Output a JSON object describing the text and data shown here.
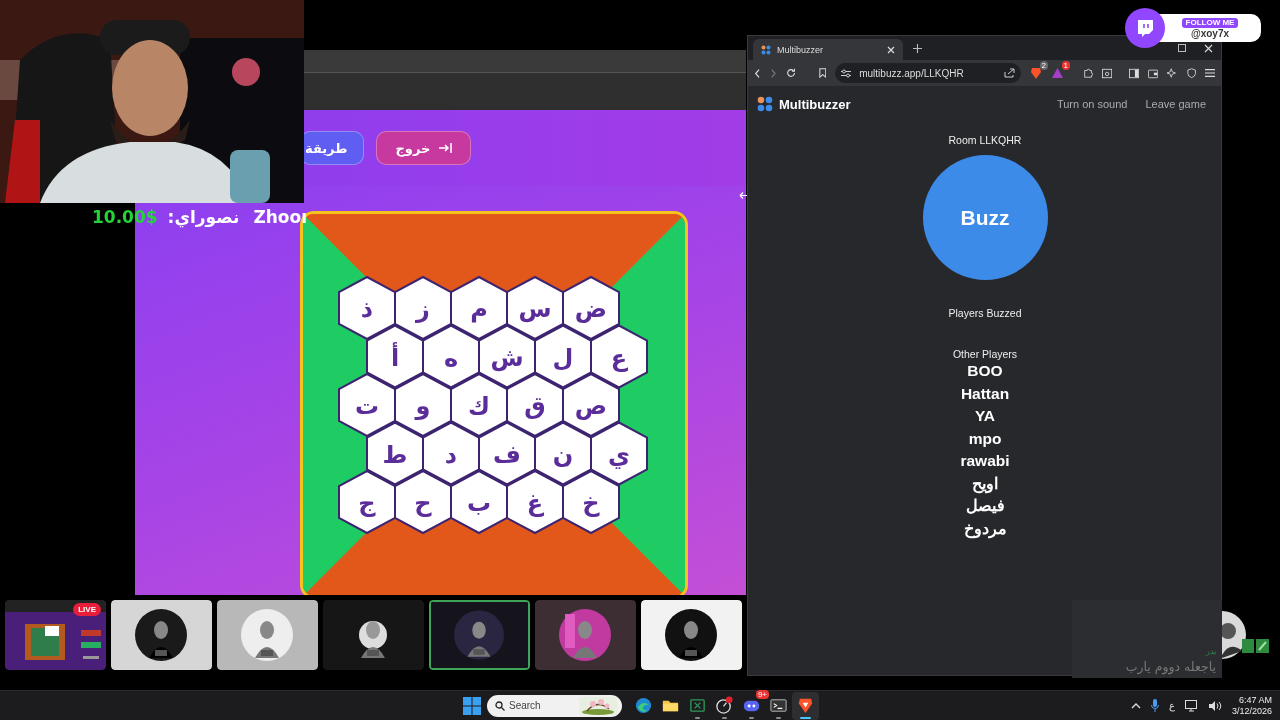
{
  "donation": {
    "amount": "10.00$",
    "donor": "نصوراي:",
    "streamer": "Zhooı"
  },
  "game": {
    "buttons": [
      {
        "label": "خروج",
        "kind": "exit"
      },
      {
        "label": "طريقة",
        "kind": "info"
      }
    ],
    "board": {
      "rows": [
        [
          "ذ",
          "ز",
          "م",
          "س",
          "ض"
        ],
        [
          "أ",
          "ه",
          "ش",
          "ل",
          "ع"
        ],
        [
          "ت",
          "و",
          "ك",
          "ق",
          "ص"
        ],
        [
          "ط",
          "د",
          "ف",
          "ن",
          "ي"
        ],
        [
          "ج",
          "ح",
          "ب",
          "غ",
          "خ"
        ]
      ]
    }
  },
  "browser": {
    "tab": {
      "title": "Multibuzzer"
    },
    "url": "multibuzz.app/LLKQHR",
    "shield_badge": "2",
    "rewards_badge": "1",
    "site": {
      "name": "Multibuzzer",
      "nav": [
        "Turn on sound",
        "Leave game"
      ],
      "room": "Room LLKQHR",
      "buzz": "Buzz",
      "buzzed_heading": "Players Buzzed",
      "others_heading": "Other Players",
      "players": [
        "BOO",
        "Hattan",
        "YA",
        "mpo",
        "rawabi",
        "اويح",
        "فيصل",
        "مردوخ"
      ]
    }
  },
  "follow": {
    "label": "FOLLOW ME",
    "handle": "@xoy7x"
  },
  "thumbnails": [
    {
      "badge": "LIVE",
      "selected": false
    },
    {
      "selected": false
    },
    {
      "selected": false
    },
    {
      "selected": false
    },
    {
      "selected": true
    },
    {
      "selected": false
    },
    {
      "selected": false
    }
  ],
  "chat_overlay": {
    "author": "بدر",
    "message": "ياجعله دووم يارب"
  },
  "taskbar": {
    "search": {
      "placeholder": "Search"
    },
    "apps": [
      {
        "kind": "edge",
        "running": false,
        "active": false
      },
      {
        "kind": "folder",
        "running": false,
        "active": false
      },
      {
        "kind": "sheet",
        "running": true,
        "active": false
      },
      {
        "kind": "dial",
        "running": true,
        "active": false
      },
      {
        "kind": "chat",
        "running": true,
        "active": false,
        "badge": "9+"
      },
      {
        "kind": "terminal",
        "running": true,
        "active": false
      },
      {
        "kind": "lion",
        "running": true,
        "active": true
      }
    ],
    "input_language": "ع",
    "time": "6:47 AM",
    "date": "3/12/2026"
  }
}
